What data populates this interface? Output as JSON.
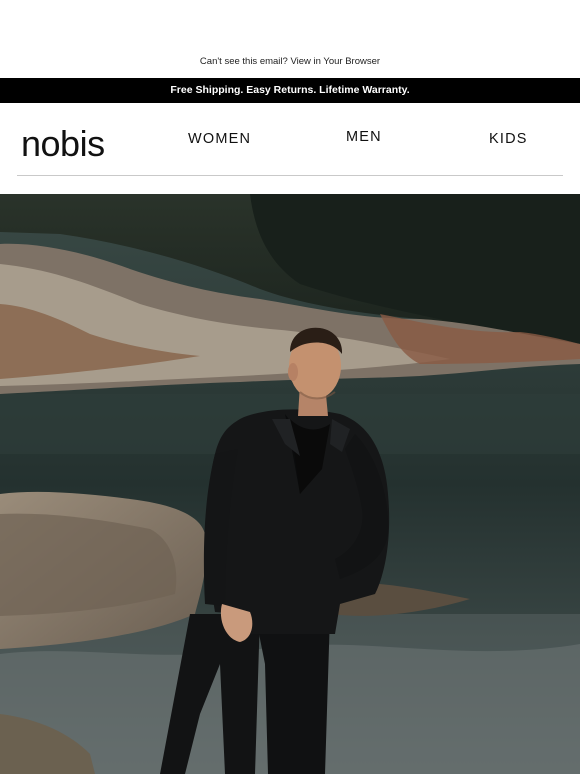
{
  "preheader": {
    "text": "Can't see this email?",
    "link": "View in Your Browser"
  },
  "shipping_bar": {
    "text": "Free Shipping. Easy Returns. Lifetime Warranty."
  },
  "header": {
    "logo": "nobis",
    "nav": [
      {
        "label": "WOMEN"
      },
      {
        "label": "MEN"
      },
      {
        "label": "KIDS"
      }
    ]
  },
  "hero": {
    "subject": "man in black jacket standing on rocks by water",
    "colors": {
      "water": "#2c3a37",
      "rock": "#8a7a6a",
      "jacket": "#151617",
      "forest": "#1f2a22"
    }
  }
}
